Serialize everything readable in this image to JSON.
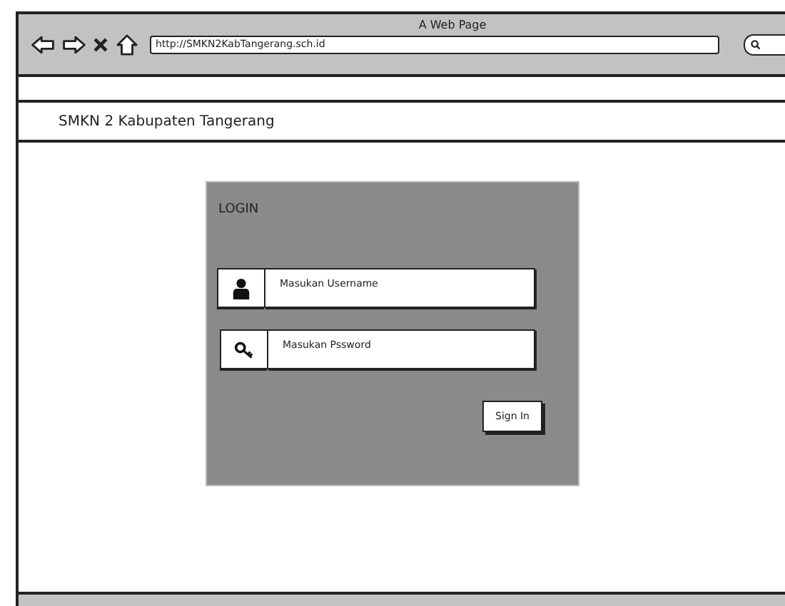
{
  "window": {
    "title": "A Web Page",
    "address": "http://SMKN2KabTangerang.sch.id"
  },
  "header": {
    "title": "SMKN 2 Kabupaten Tangerang"
  },
  "login": {
    "title": "LOGIN",
    "fields": [
      {
        "kind": "user",
        "placeholder": "Masukan Username"
      },
      {
        "kind": "key",
        "placeholder": "Masukan Pssword"
      }
    ],
    "button": "Sign In"
  }
}
